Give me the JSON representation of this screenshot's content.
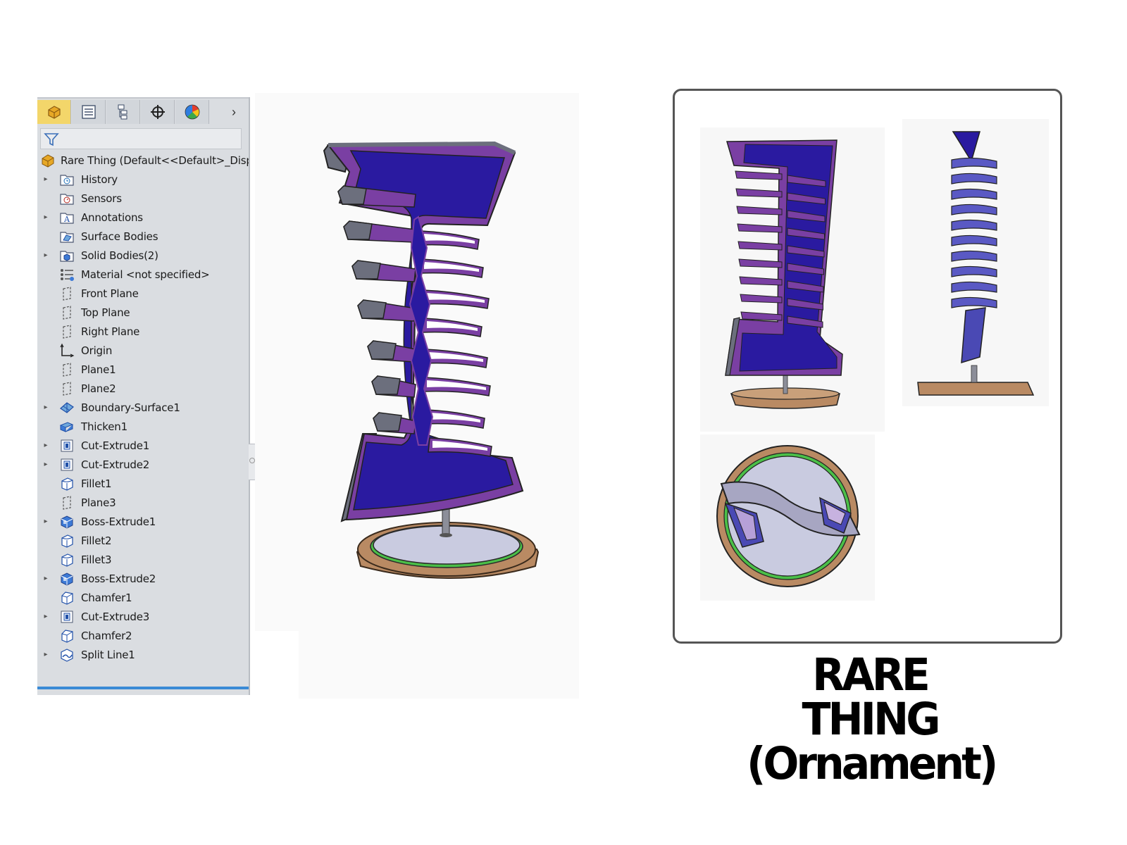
{
  "feature_tree": {
    "tabs": [
      {
        "name": "featuremanager-tab",
        "icon": "part-icon"
      },
      {
        "name": "propertymanager-tab",
        "icon": "property-list-icon"
      },
      {
        "name": "configurationmanager-tab",
        "icon": "configuration-icon"
      },
      {
        "name": "dimxpert-tab",
        "icon": "crosshair-icon"
      },
      {
        "name": "appearance-tab",
        "icon": "color-wheel-icon"
      }
    ],
    "more_tabs_glyph": "›",
    "root": {
      "label": "Rare Thing  (Default<<Default>_Display",
      "icon": "part-icon"
    },
    "items": [
      {
        "label": "History",
        "icon": "history-folder-icon",
        "expandable": true
      },
      {
        "label": "Sensors",
        "icon": "sensor-folder-icon",
        "expandable": false
      },
      {
        "label": "Annotations",
        "icon": "annotations-icon",
        "expandable": true
      },
      {
        "label": "Surface Bodies",
        "icon": "surface-bodies-folder-icon",
        "expandable": false
      },
      {
        "label": "Solid Bodies(2)",
        "icon": "solid-bodies-folder-icon",
        "expandable": true
      },
      {
        "label": "Material <not specified>",
        "icon": "material-icon",
        "expandable": false
      },
      {
        "label": "Front Plane",
        "icon": "plane-icon",
        "expandable": false
      },
      {
        "label": "Top Plane",
        "icon": "plane-icon",
        "expandable": false
      },
      {
        "label": "Right Plane",
        "icon": "plane-icon",
        "expandable": false
      },
      {
        "label": "Origin",
        "icon": "origin-icon",
        "expandable": false
      },
      {
        "label": "Plane1",
        "icon": "plane-icon",
        "expandable": false
      },
      {
        "label": "Plane2",
        "icon": "plane-icon",
        "expandable": false
      },
      {
        "label": "Boundary-Surface1",
        "icon": "boundary-surface-icon",
        "expandable": true
      },
      {
        "label": "Thicken1",
        "icon": "thicken-icon",
        "expandable": false
      },
      {
        "label": "Cut-Extrude1",
        "icon": "cut-extrude-icon",
        "expandable": true
      },
      {
        "label": "Cut-Extrude2",
        "icon": "cut-extrude-icon",
        "expandable": true
      },
      {
        "label": "Fillet1",
        "icon": "fillet-icon",
        "expandable": false
      },
      {
        "label": "Plane3",
        "icon": "plane-icon",
        "expandable": false
      },
      {
        "label": "Boss-Extrude1",
        "icon": "boss-extrude-icon",
        "expandable": true
      },
      {
        "label": "Fillet2",
        "icon": "fillet-icon",
        "expandable": false
      },
      {
        "label": "Fillet3",
        "icon": "fillet-icon",
        "expandable": false
      },
      {
        "label": "Boss-Extrude2",
        "icon": "boss-extrude-icon",
        "expandable": true
      },
      {
        "label": "Chamfer1",
        "icon": "chamfer-icon",
        "expandable": false
      },
      {
        "label": "Cut-Extrude3",
        "icon": "cut-extrude-icon",
        "expandable": true
      },
      {
        "label": "Chamfer2",
        "icon": "chamfer-icon",
        "expandable": false
      },
      {
        "label": "Split Line1",
        "icon": "split-line-icon",
        "expandable": true
      }
    ]
  },
  "caption": {
    "line1": "RARE THING",
    "line2": "(Ornament)"
  },
  "colors": {
    "panel_bg": "#dadde1",
    "active_tab": "#f3d66a",
    "body_blue": "#2a1aa0",
    "edge_purple": "#7a3fa3",
    "edge_gray": "#6c6f7d",
    "base_top": "#c9cbe0",
    "base_ring": "#4bbf48",
    "base_side": "#b98a63"
  }
}
